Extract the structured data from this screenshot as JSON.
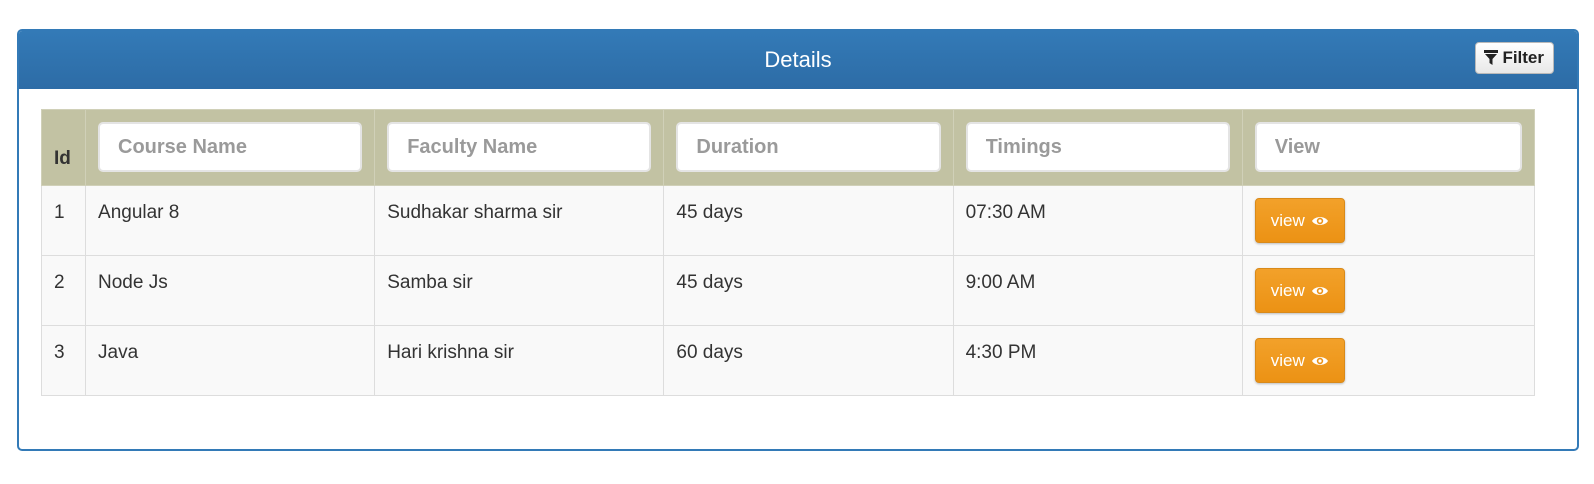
{
  "panel": {
    "title": "Details",
    "filter_label": "Filter",
    "filter_icon": "funnel-icon"
  },
  "table": {
    "id_header": "Id",
    "column_filters": [
      {
        "placeholder": "Course Name"
      },
      {
        "placeholder": "Faculty Name"
      },
      {
        "placeholder": "Duration"
      },
      {
        "placeholder": "Timings"
      },
      {
        "placeholder": "View"
      }
    ],
    "rows": [
      {
        "id": "1",
        "course": "Angular 8",
        "faculty": "Sudhakar sharma sir",
        "duration": "45 days",
        "timing": "07:30 AM",
        "view_label": "view"
      },
      {
        "id": "2",
        "course": "Node Js",
        "faculty": "Samba sir",
        "duration": "45 days",
        "timing": "9:00 AM",
        "view_label": "view"
      },
      {
        "id": "3",
        "course": "Java",
        "faculty": "Hari krishna sir",
        "duration": "60 days",
        "timing": "4:30 PM",
        "view_label": "view"
      }
    ],
    "view_icon": "eye-icon"
  },
  "colors": {
    "panel_primary": "#337ab7",
    "header_row": "#c2c2a3",
    "view_button": "#f0a02a"
  }
}
